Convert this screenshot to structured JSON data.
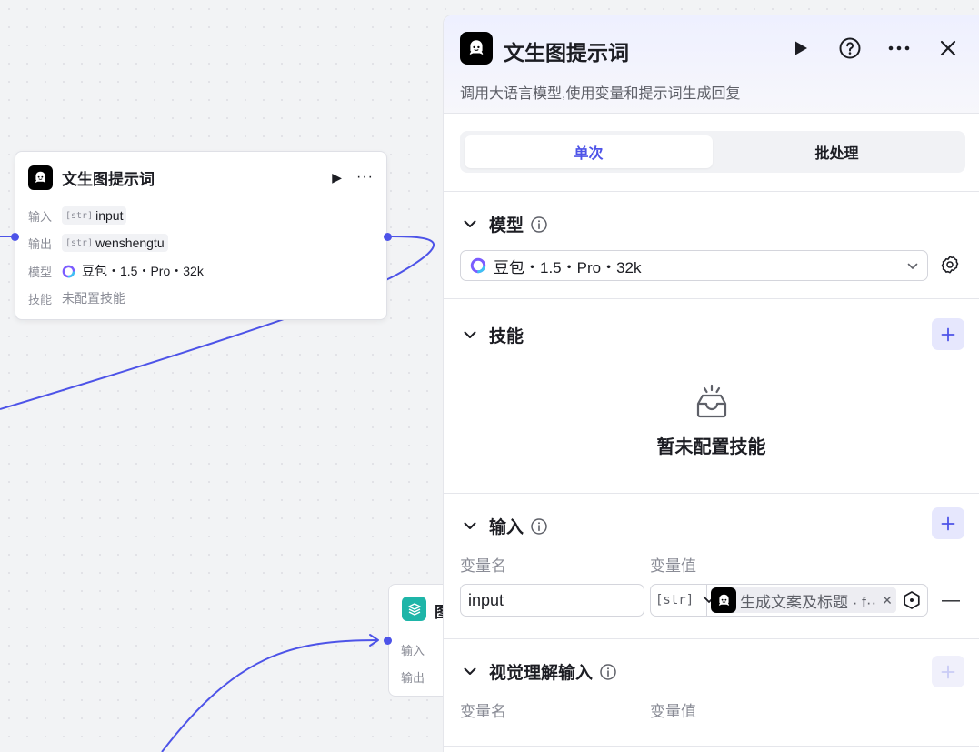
{
  "canvas": {
    "node": {
      "title": "文生图提示词",
      "input_label": "输入",
      "input_type": "[str]",
      "input_value": "input",
      "output_label": "输出",
      "output_type": "[str]",
      "output_value": "wenshengtu",
      "model_label": "模型",
      "model_value": "豆包・1.5・Pro・32k",
      "skill_label": "技能",
      "skill_value": "未配置技能"
    },
    "node2": {
      "title_partial": "图",
      "input_label": "输入",
      "output_label": "输出"
    }
  },
  "panel": {
    "title": "文生图提示词",
    "description": "调用大语言模型,使用变量和提示词生成回复",
    "tabs": [
      "单次",
      "批处理"
    ],
    "active_tab": "单次",
    "model_section": {
      "label": "模型",
      "selected": "豆包・1.5・Pro・32k"
    },
    "skill_section": {
      "label": "技能",
      "empty_text": "暂未配置技能"
    },
    "input_section": {
      "label": "输入",
      "col_name": "变量名",
      "col_value": "变量值",
      "rows": [
        {
          "name": "input",
          "type": "[str]",
          "ref": "生成文案及标题 · f··"
        }
      ]
    },
    "vision_section": {
      "label": "视觉理解输入",
      "col_name": "变量名",
      "col_value": "变量值"
    }
  },
  "colors": {
    "accent": "#4d53e8",
    "edge": "#4d53e8",
    "node2_icon": "#1eb5a8"
  }
}
